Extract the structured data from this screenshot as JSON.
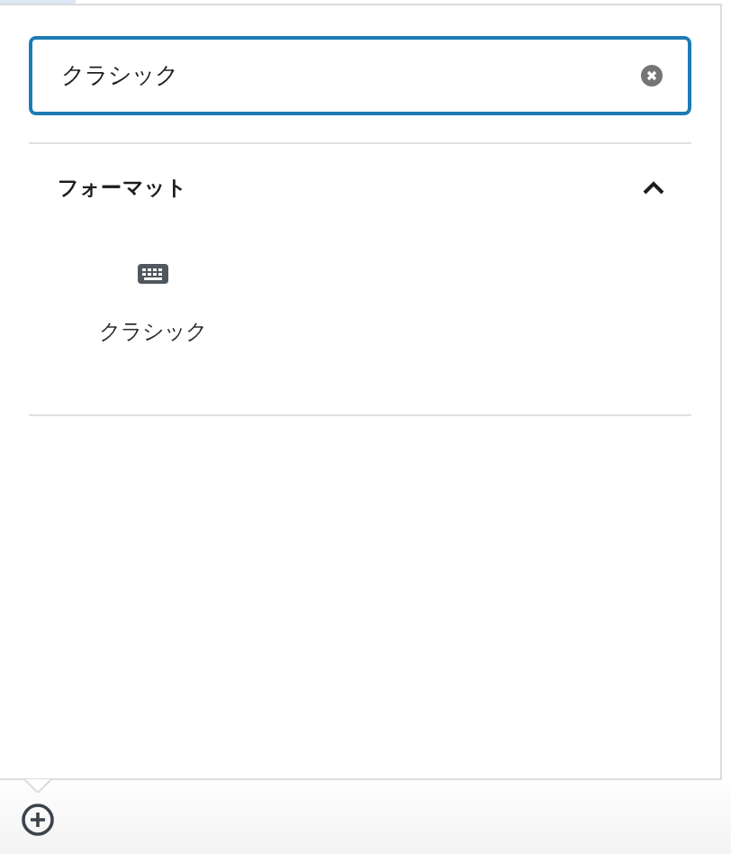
{
  "search": {
    "value": "クラシック"
  },
  "section": {
    "title": "フォーマット",
    "expanded": true,
    "blocks": [
      {
        "label": "クラシック"
      }
    ]
  }
}
